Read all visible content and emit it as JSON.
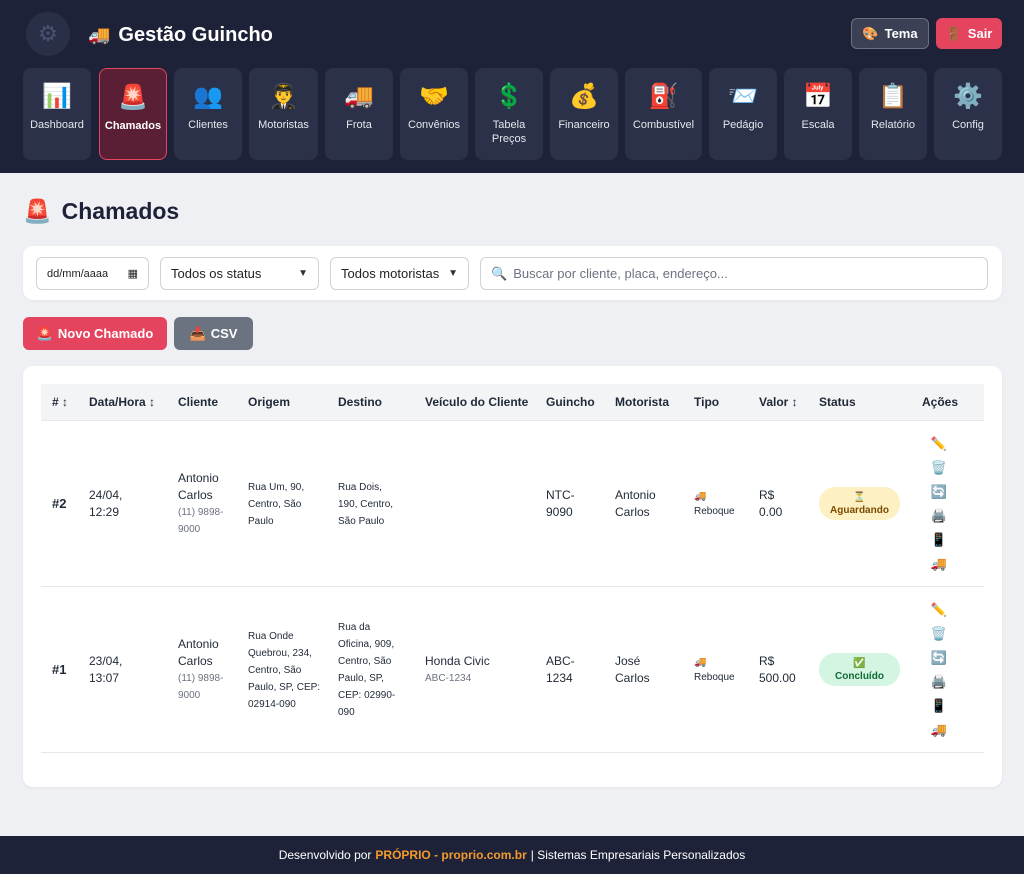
{
  "header": {
    "brand_icon": "🚚",
    "title": "Gestão Guincho",
    "tema": {
      "icon": "🎨",
      "label": "Tema"
    },
    "sair": {
      "icon": "🚪",
      "label": "Sair"
    }
  },
  "nav": [
    {
      "id": "dashboard",
      "icon": "📊",
      "label": "Dashboard"
    },
    {
      "id": "chamados",
      "icon": "🚨",
      "label": "Chamados",
      "active": true
    },
    {
      "id": "clientes",
      "icon": "👥",
      "label": "Clientes"
    },
    {
      "id": "motoristas",
      "icon": "👨‍✈️",
      "label": "Motoristas"
    },
    {
      "id": "frota",
      "icon": "🚚",
      "label": "Frota"
    },
    {
      "id": "convenios",
      "icon": "🤝",
      "label": "Convênios"
    },
    {
      "id": "tabela-precos",
      "icon": "💲",
      "label": "Tabela Preços"
    },
    {
      "id": "financeiro",
      "icon": "💰",
      "label": "Financeiro"
    },
    {
      "id": "combustivel",
      "icon": "⛽",
      "label": "Combustível"
    },
    {
      "id": "pedagio",
      "icon": "📨",
      "label": "Pedágio"
    },
    {
      "id": "escala",
      "icon": "📅",
      "label": "Escala"
    },
    {
      "id": "relatorio",
      "icon": "📋",
      "label": "Relatório"
    },
    {
      "id": "config",
      "icon": "⚙️",
      "label": "Config"
    }
  ],
  "page": {
    "icon": "🚨",
    "title": "Chamados"
  },
  "filters": {
    "date_placeholder": "dd/mm/aaaa",
    "status_selected": "Todos os status",
    "motorista_selected": "Todos motoristas",
    "search_placeholder": "Buscar por cliente, placa, endereço..."
  },
  "buttons": {
    "novo": {
      "icon": "🚨",
      "label": "Novo Chamado"
    },
    "csv": {
      "icon": "📥",
      "label": "CSV"
    }
  },
  "table": {
    "headers": {
      "num": "# ↕",
      "datahora": "Data/Hora ↕",
      "cliente": "Cliente",
      "origem": "Origem",
      "destino": "Destino",
      "veiculo": "Veículo do Cliente",
      "guincho": "Guincho",
      "motorista": "Motorista",
      "tipo": "Tipo",
      "valor": "Valor ↕",
      "status": "Status",
      "acoes": "Ações"
    },
    "rows": [
      {
        "num": "#2",
        "data": "24/04,",
        "hora": "12:29",
        "cliente_l1": "Antonio",
        "cliente_l2": "Carlos",
        "fone_l1": "(11) 9898-",
        "fone_l2": "9000",
        "origem": [
          "Rua Um, 90,",
          "Centro, São",
          "Paulo"
        ],
        "destino": [
          "Rua Dois,",
          "190, Centro,",
          "São Paulo"
        ],
        "veiculo": "",
        "placa": "",
        "guincho_l1": "NTC-",
        "guincho_l2": "9090",
        "motorista_l1": "Antonio",
        "motorista_l2": "Carlos",
        "tipo_icon": "🚚",
        "tipo": "Reboque",
        "valor_l1": "R$",
        "valor_l2": "0.00",
        "status_icon": "⏳",
        "status": "Aguardando"
      },
      {
        "num": "#1",
        "data": "23/04,",
        "hora": "13:07",
        "cliente_l1": "Antonio",
        "cliente_l2": "Carlos",
        "fone_l1": "(11) 9898-",
        "fone_l2": "9000",
        "origem": [
          "Rua Onde",
          "Quebrou, 234,",
          "Centro, São",
          "Paulo, SP, CEP:",
          "02914-090"
        ],
        "destino": [
          "Rua da",
          "Oficina, 909,",
          "Centro, São",
          "Paulo, SP,",
          "CEP: 02990-",
          "090"
        ],
        "veiculo": "Honda Civic",
        "placa": "ABC-1234",
        "guincho_l1": "ABC-",
        "guincho_l2": "1234",
        "motorista_l1": "José",
        "motorista_l2": "Carlos",
        "tipo_icon": "🚚",
        "tipo": "Reboque",
        "valor_l1": "R$",
        "valor_l2": "500.00",
        "status_icon": "✅",
        "status": "Concluído"
      }
    ],
    "actions": [
      {
        "id": "edit",
        "icon": "✏️"
      },
      {
        "id": "delete",
        "icon": "🗑️"
      },
      {
        "id": "refresh",
        "icon": "🔄"
      },
      {
        "id": "print",
        "icon": "🖨️"
      },
      {
        "id": "phone",
        "icon": "📱"
      },
      {
        "id": "truck",
        "icon": "🚚"
      }
    ]
  },
  "footer": {
    "prefix": "Desenvolvido por",
    "brand": "PRÓPRIO - proprio.com.br",
    "suffix": "| Sistemas Empresariais Personalizados"
  }
}
